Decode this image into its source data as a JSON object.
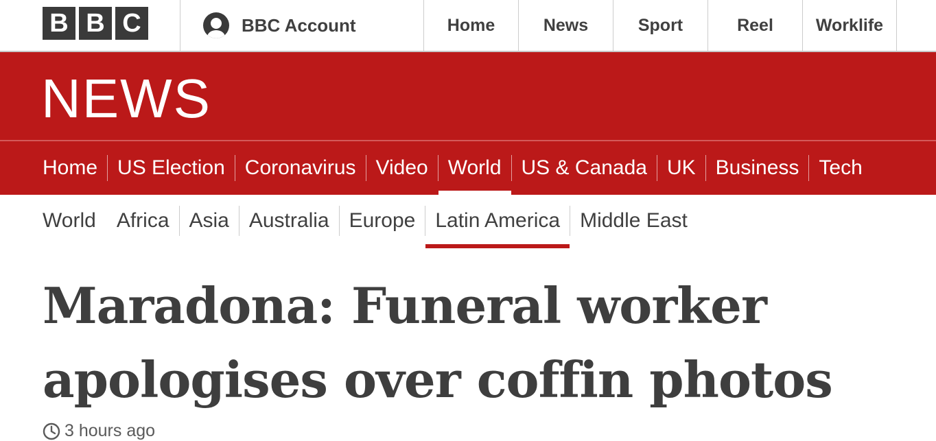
{
  "topbar": {
    "logo_letters": [
      "B",
      "B",
      "C"
    ],
    "account_label": "BBC Account",
    "account_icon": "user-avatar-icon",
    "nav": [
      "Home",
      "News",
      "Sport",
      "Reel",
      "Worklife"
    ]
  },
  "banner": {
    "wordmark": "NEWS",
    "background_color": "#bb1919"
  },
  "primary_nav": {
    "items": [
      "Home",
      "US Election",
      "Coronavirus",
      "Video",
      "World",
      "US & Canada",
      "UK",
      "Business",
      "Tech"
    ],
    "active": "World"
  },
  "secondary_nav": {
    "items": [
      "World",
      "Africa",
      "Asia",
      "Australia",
      "Europe",
      "Latin America",
      "Middle East"
    ],
    "active": "Latin America",
    "accent_color": "#bb1919"
  },
  "article": {
    "headline": "Maradona: Funeral worker apologises over coffin photos",
    "timestamp": "3 hours ago",
    "timestamp_icon": "clock-icon"
  }
}
